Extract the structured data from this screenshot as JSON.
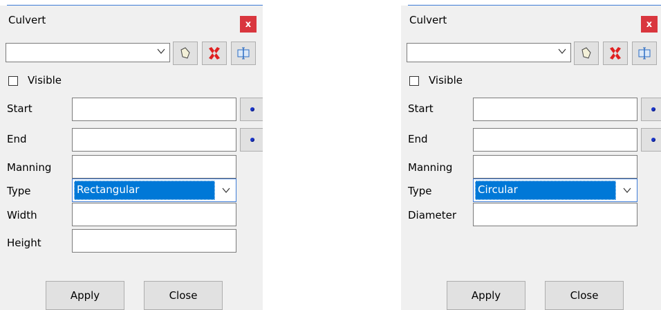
{
  "dialogs": [
    {
      "title": "Culvert",
      "close_glyph": "x",
      "combo_value": "",
      "visible_label": "Visible",
      "visible_checked": false,
      "fields": {
        "start_label": "Start",
        "end_label": "End",
        "manning_label": "Manning",
        "type_label": "Type",
        "type_value": "Rectangular",
        "width_label": "Width",
        "height_label": "Height"
      },
      "apply_label": "Apply",
      "close_label": "Close"
    },
    {
      "title": "Culvert",
      "close_glyph": "x",
      "combo_value": "",
      "visible_label": "Visible",
      "visible_checked": false,
      "fields": {
        "start_label": "Start",
        "end_label": "End",
        "manning_label": "Manning",
        "type_label": "Type",
        "type_value": "Circular",
        "diameter_label": "Diameter"
      },
      "apply_label": "Apply",
      "close_label": "Close"
    }
  ],
  "icons": [
    "chevron-down-icon",
    "edit-shape-icon",
    "delete-icon",
    "properties-icon",
    "pick-point-icon"
  ],
  "colors": {
    "accent": "#0078d7",
    "close_red": "#d9363e",
    "delete_red": "#e02020",
    "point_blue": "#1a35c8"
  }
}
